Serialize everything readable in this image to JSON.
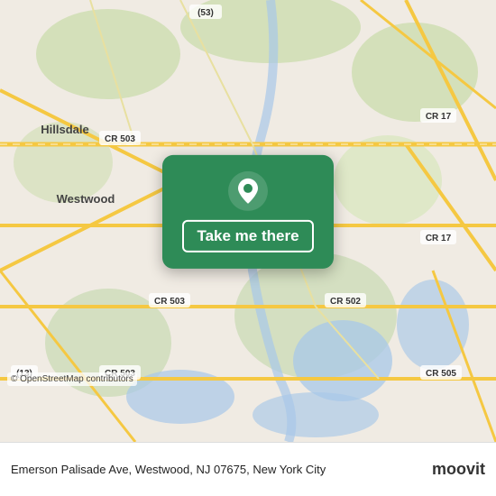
{
  "map": {
    "background_color": "#e8e0d8"
  },
  "popup": {
    "background_color": "#2e8b57",
    "button_label": "Take me there"
  },
  "bottom_bar": {
    "address": "Emerson Palisade Ave, Westwood, NJ 07675, New York City"
  },
  "osm_credit": "© OpenStreetMap contributors",
  "moovit": {
    "text": "moovit"
  },
  "road_labels": {
    "cr503_top": "CR 503",
    "cr503_mid": "CR 503",
    "cr503_bot": "CR 503",
    "cr502": "CR 502",
    "cr17_top": "CR 17",
    "cr17_mid": "CR 17",
    "cr505": "CR 505",
    "n53": "(53)",
    "n13": "(13)",
    "hillsdale": "Hillsdale",
    "westwood": "Westwood"
  }
}
